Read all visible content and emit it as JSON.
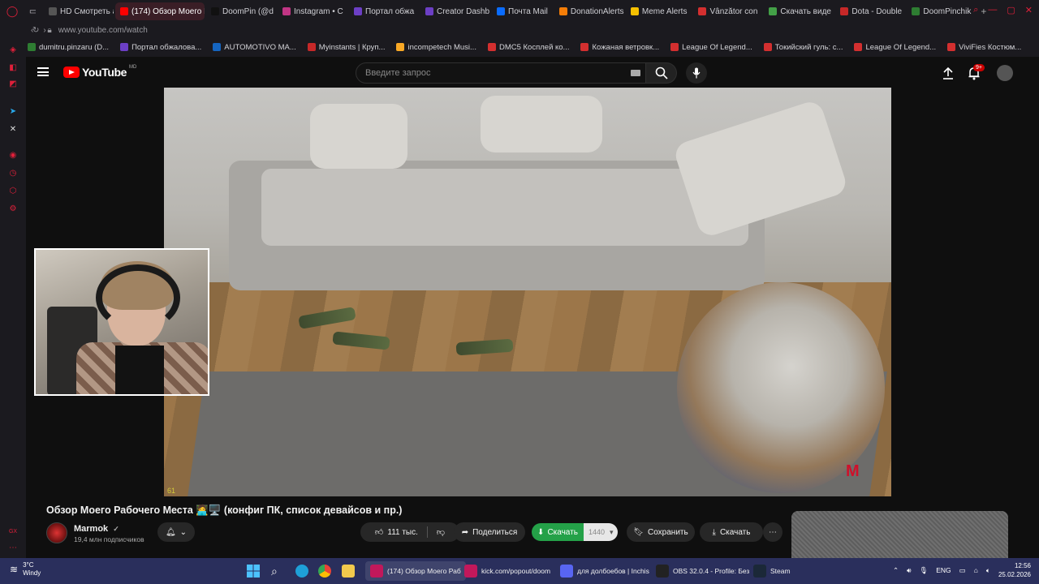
{
  "browser": {
    "tabs": [
      {
        "label": "HD Смотреть аниме",
        "color": "#555555",
        "active": false
      },
      {
        "label": "(174) Обзор Моего Р",
        "color": "#ff0000",
        "active": true
      },
      {
        "label": "DoomPin (@d",
        "color": "#111111",
        "active": false
      },
      {
        "label": "Instagram • С",
        "color": "#c13584",
        "active": false
      },
      {
        "label": "Портал обжа",
        "color": "#6c3fc5",
        "active": false
      },
      {
        "label": "Creator Dashb",
        "color": "#6c3fc5",
        "active": false
      },
      {
        "label": "Почта Mail",
        "color": "#0a6cff",
        "active": false
      },
      {
        "label": "DonationAlerts",
        "color": "#f57d07",
        "active": false
      },
      {
        "label": "Meme Alerts",
        "color": "#f5c000",
        "active": false
      },
      {
        "label": "Vânzător con",
        "color": "#d32f2f",
        "active": false
      },
      {
        "label": "Скачать виде",
        "color": "#43a047",
        "active": false
      },
      {
        "label": "Dota - Double",
        "color": "#c62828",
        "active": false
      },
      {
        "label": "DoomPinchik",
        "color": "#2e7d32",
        "active": false
      }
    ],
    "new_tab": "+",
    "url": "www.youtube.com/watch",
    "bookmarks": [
      {
        "label": "dumitru.pinzaru (D...",
        "color": "#2e7d32"
      },
      {
        "label": "Портал обжалова...",
        "color": "#6c3fc5"
      },
      {
        "label": "AUTOMOTIVO MA...",
        "color": "#1565c0"
      },
      {
        "label": "Myinstants | Круп...",
        "color": "#c62828"
      },
      {
        "label": "incompetech Musi...",
        "color": "#f9a825"
      },
      {
        "label": "DMC5 Косплей ко...",
        "color": "#d32f2f"
      },
      {
        "label": "Кожаная ветровк...",
        "color": "#d32f2f"
      },
      {
        "label": "League Of Legend...",
        "color": "#d32f2f"
      },
      {
        "label": "Токийский гуль: с...",
        "color": "#d32f2f"
      },
      {
        "label": "League Of Legend...",
        "color": "#d32f2f"
      },
      {
        "label": "ViviFies Костюм...",
        "color": "#d32f2f"
      }
    ]
  },
  "youtube": {
    "logo_text": "YouTube",
    "region": "MD",
    "search_placeholder": "Введите запрос",
    "notifications_badge": "9+",
    "video": {
      "fps_overlay": "61",
      "title": "Обзор Моего Рабочего Места 🧑‍💻🖥️ (конфиг ПК, список девайсов и пр.)",
      "channel_name": "Marmok",
      "channel_verified": "✓",
      "subscribers": "19,4 млн подписчиков",
      "likes": "111 тыс.",
      "share_label": "Поделиться",
      "download_green_label": "Скачать",
      "download_resolution": "1440",
      "save_label": "Сохранить",
      "download_label": "Скачать",
      "more_label": "⋯"
    }
  },
  "taskbar": {
    "weather_temp": "3°C",
    "weather_desc": "Windy",
    "apps": [
      {
        "label": "(174) Обзор Моего Раб",
        "color": "#c2185b",
        "active": true
      },
      {
        "label": "kick.com/popout/doom",
        "color": "#c2185b",
        "active": false
      },
      {
        "label": "для долбоебов | Inchis",
        "color": "#5865f2",
        "active": false
      },
      {
        "label": "OBS 32.0.4 - Profile: Без",
        "color": "#222222",
        "active": false
      },
      {
        "label": "Steam",
        "color": "#1b2838",
        "active": false
      }
    ],
    "language": "ENG",
    "time": "12:56",
    "date": "25.02.2026"
  }
}
